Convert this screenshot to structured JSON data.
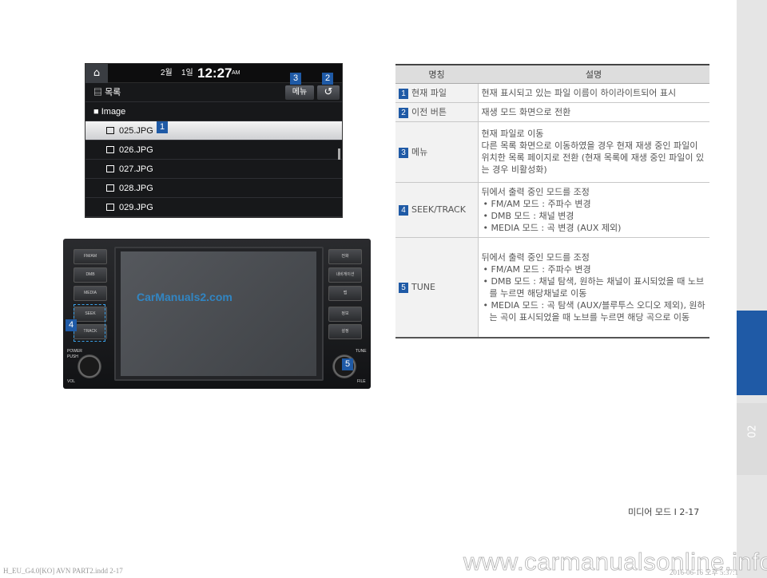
{
  "sidebar": {
    "chapter": "02"
  },
  "screen": {
    "home_icon": "home-icon",
    "status": {
      "month": "2월",
      "day": "1일",
      "time": "12:27",
      "ampm": "AM"
    },
    "list_title": "목록",
    "menu_btn": "메뉴",
    "back_icon": "back-arrow-icon",
    "folder": "Image",
    "files": [
      "025.JPG",
      "026.JPG",
      "027.JPG",
      "028.JPG",
      "029.JPG"
    ],
    "selected_index": 0
  },
  "callouts": [
    "1",
    "2",
    "3",
    "4",
    "5"
  ],
  "unit": {
    "left_buttons": [
      "FM/AM",
      "DMB",
      "MEDIA",
      "SEEK",
      "TRACK"
    ],
    "right_buttons": [
      "전화",
      "내비게이션",
      "맵",
      "정보",
      "설정"
    ],
    "labels": {
      "power": "POWER",
      "push": "PUSH",
      "vol": "VOL",
      "tune": "TUNE",
      "file": "FILE"
    },
    "watermark": "CarManuals2.com"
  },
  "table": {
    "headers": [
      "명칭",
      "설명"
    ],
    "rows": [
      {
        "num": "1",
        "name": "현재 파일",
        "lines": [
          "현재 표시되고 있는 파일 이름이 하이라이트되어 표시"
        ]
      },
      {
        "num": "2",
        "name": "이전 버튼",
        "lines": [
          "재생 모드 화면으로 전환"
        ]
      },
      {
        "num": "3",
        "name": "메뉴",
        "lines": [
          "현재 파일로 이동",
          "다른 목록 화면으로 이동하였을 경우 현재 재생 중인 파일이 위치한 목록 페이지로 전환 (현재 목록에 재생 중인 파일이 있는 경우 비활성화)"
        ]
      },
      {
        "num": "4",
        "name": "SEEK/TRACK",
        "intro": "뒤에서 출력 중인 모드를 조정",
        "bullets": [
          "FM/AM 모드 : 주파수 변경",
          "DMB 모드 : 채널 변경",
          "MEDIA 모드 : 곡 변경 (AUX 제외)"
        ]
      },
      {
        "num": "5",
        "name": "TUNE",
        "intro": "뒤에서 출력 중인 모드를 조정",
        "bullets": [
          "FM/AM 모드 : 주파수 변경",
          "DMB 모드 : 채널 탐색, 원하는 채널이 표시되었을 때 노브를 누르면 해당채널로 이동",
          "MEDIA 모드 : 곡 탐색 (AUX/블루투스 오디오 제외), 원하는 곡이 표시되었을 때 노브를 누르면 해당 곡으로 이동"
        ]
      }
    ]
  },
  "page_number": "미디어 모드 I 2-17",
  "footer_left": "H_EU_G4.0[KO] AVN PART2.indd   2-17",
  "footer_right": "2016-06-16   오후 5:37:1",
  "site_watermark": "www.carmanualsonline.info"
}
